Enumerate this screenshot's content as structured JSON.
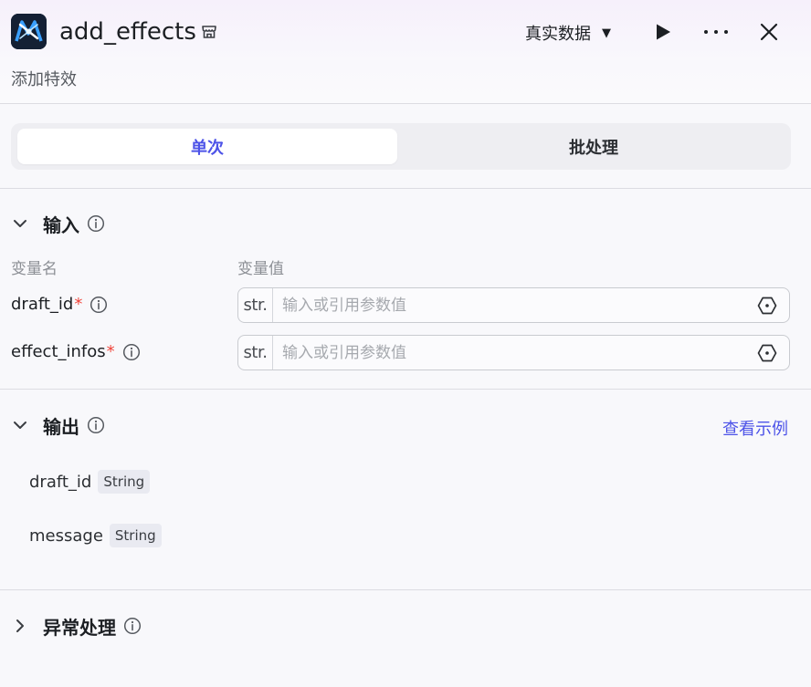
{
  "header": {
    "title": "add_effects",
    "subtitle": "添加特效",
    "mode_select": {
      "label": "真实数据",
      "caret": "▼"
    }
  },
  "tabs": [
    {
      "label": "单次",
      "active": true
    },
    {
      "label": "批处理",
      "active": false
    }
  ],
  "input_section": {
    "title": "输入",
    "col_name": "变量名",
    "col_value": "变量值",
    "params": [
      {
        "name": "draft_id",
        "required_mark": "*",
        "type": "str.",
        "placeholder": "输入或引用参数值"
      },
      {
        "name": "effect_infos",
        "required_mark": "*",
        "type": "str.",
        "placeholder": "输入或引用参数值"
      }
    ]
  },
  "output_section": {
    "title": "输出",
    "view_example": "查看示例",
    "outputs": [
      {
        "name": "draft_id",
        "type": "String"
      },
      {
        "name": "message",
        "type": "String"
      }
    ]
  },
  "exception_section": {
    "title": "异常处理"
  },
  "colors": {
    "accent": "#4d53e8",
    "required": "#f0443a"
  }
}
